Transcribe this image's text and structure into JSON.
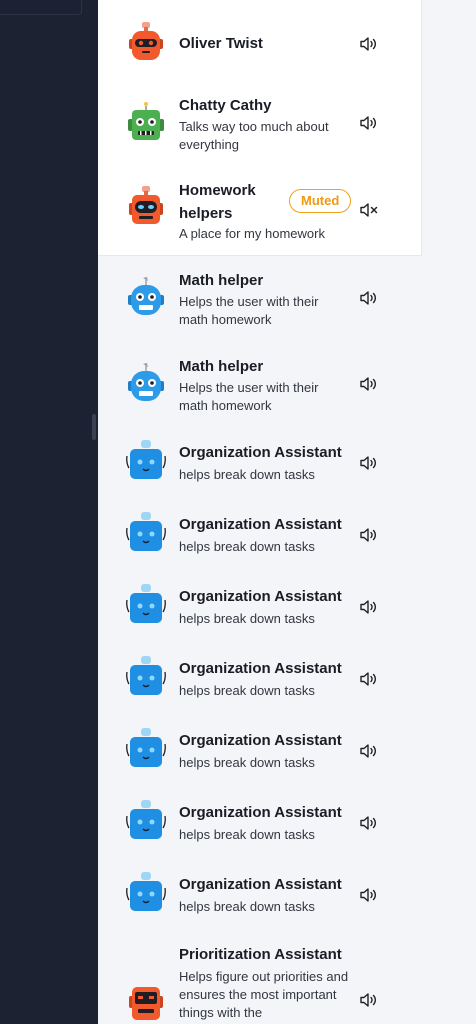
{
  "conversations": [
    {
      "title": "Oliver Twist",
      "desc": "",
      "avatar": "orange-robot-icon",
      "muted": false
    },
    {
      "title": "Chatty Cathy",
      "desc": "Talks way too much about everything",
      "avatar": "green-robot-icon",
      "muted": false
    },
    {
      "title": "Homework helpers",
      "desc": "A place for my homework",
      "avatar": "orange-robot-visor-icon",
      "muted": true,
      "badge": "Muted"
    },
    {
      "title": "Math helper",
      "desc": "Helps the user with their math homework",
      "avatar": "blue-robot-round-icon",
      "muted": false
    },
    {
      "title": "Math helper",
      "desc": "Helps the user with their math homework",
      "avatar": "blue-robot-round-icon",
      "muted": false
    },
    {
      "title": "Organization Assistant",
      "desc": "helps break down tasks",
      "avatar": "blue-robot-square-icon",
      "muted": false
    },
    {
      "title": "Organization Assistant",
      "desc": "helps break down tasks",
      "avatar": "blue-robot-square-icon",
      "muted": false
    },
    {
      "title": "Organization Assistant",
      "desc": "helps break down tasks",
      "avatar": "blue-robot-square-icon",
      "muted": false
    },
    {
      "title": "Organization Assistant",
      "desc": "helps break down tasks",
      "avatar": "blue-robot-square-icon",
      "muted": false
    },
    {
      "title": "Organization Assistant",
      "desc": "helps break down tasks",
      "avatar": "blue-robot-square-icon",
      "muted": false
    },
    {
      "title": "Organization Assistant",
      "desc": "helps break down tasks",
      "avatar": "blue-robot-square-icon",
      "muted": false
    },
    {
      "title": "Organization Assistant",
      "desc": "helps break down tasks",
      "avatar": "blue-robot-square-icon",
      "muted": false
    },
    {
      "title": "Prioritization Assistant",
      "desc": "Helps figure out priorities and ensures the most important things with the",
      "avatar": "orange-robot-dark-icon",
      "muted": false
    }
  ],
  "colors": {
    "sidebar_bg": "#1d2232",
    "panel_bg": "#f4f5f8",
    "selected_bg": "#ffffff",
    "badge": "#f09a10"
  }
}
